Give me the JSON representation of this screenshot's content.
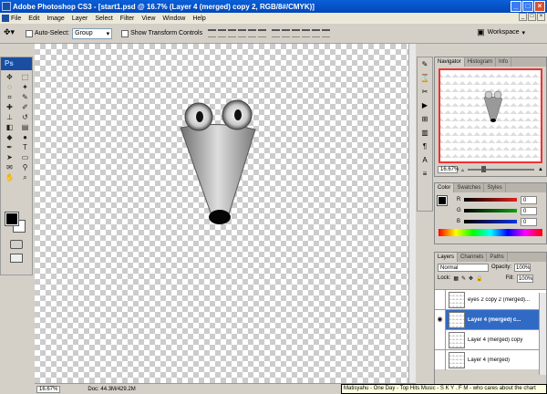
{
  "titlebar": {
    "title": "Adobe Photoshop CS3 - [start1.psd @ 16.7% (Layer 4 (merged) copy 2, RGB/8#/CMYK)]"
  },
  "menu": {
    "items": [
      "File",
      "Edit",
      "Image",
      "Layer",
      "Select",
      "Filter",
      "View",
      "Window",
      "Help"
    ]
  },
  "options": {
    "auto_select_label": "Auto-Select:",
    "auto_select_value": "Group",
    "show_transform_label": "Show Transform Controls",
    "workspace_label": "Workspace"
  },
  "toolbox": {
    "logo": "Ps"
  },
  "status": {
    "zoom": "16.67%",
    "doc": "Doc: 44.3M/429.2M"
  },
  "navigator": {
    "tabs": [
      "Navigator",
      "Histogram",
      "Info"
    ],
    "zoom": "16.67%",
    "slider_fraction": 0.2
  },
  "color_panel": {
    "tabs": [
      "Color",
      "Swatches",
      "Styles"
    ],
    "channels": [
      {
        "label": "R",
        "value": "0",
        "color": "#e02020"
      },
      {
        "label": "G",
        "value": "0",
        "color": "#10a010"
      },
      {
        "label": "B",
        "value": "0",
        "color": "#1030e0"
      }
    ]
  },
  "layers_panel": {
    "tabs": [
      "Layers",
      "Channels",
      "Paths"
    ],
    "blend_mode": "Normal",
    "opacity_label": "Opacity:",
    "opacity": "100%",
    "lock_label": "Lock:",
    "fill_label": "Fill:",
    "fill": "100%",
    "layers": [
      {
        "name": "eyes 2 copy 2 (merged)...",
        "visible": false,
        "selected": false
      },
      {
        "name": "Layer 4 (merged) c...",
        "visible": true,
        "selected": true
      },
      {
        "name": "Layer 4 (merged) copy",
        "visible": false,
        "selected": false
      },
      {
        "name": "Layer 4 (merged)",
        "visible": false,
        "selected": false
      }
    ]
  },
  "tooltip": {
    "text": "Matisyahu - One Day - Top Hits Music - S K Y . F M - who cares about the chart"
  }
}
